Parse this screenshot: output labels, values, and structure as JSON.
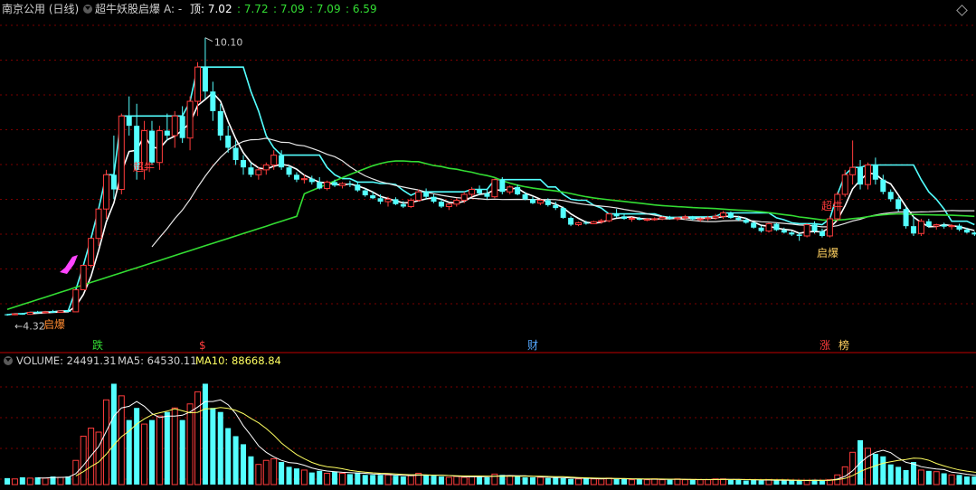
{
  "header": {
    "stock_label": "南京公用 (日线)",
    "indicator_name": "超牛妖股启爆",
    "a_label": "A: -",
    "top_label": "顶: 7.02",
    "v1": ": 7.72",
    "v2": ": 7.09",
    "v3": ": 7.09",
    "v4": ": 6.59"
  },
  "volume_header": {
    "volume": "VOLUME: 24491.31",
    "ma5": "MA5: 64530.11",
    "ma10": "MA10: 88668.84"
  },
  "colors": {
    "up": "#ff3c3c",
    "down": "#54ffff",
    "white_line": "#ffffff",
    "cyan_line": "#54ffff",
    "green_line": "#33dd33",
    "grid": "#7a0000",
    "ma10": "#ffff60",
    "magenta": "#ff44ff"
  },
  "chart_data": {
    "type": "candlestick",
    "price_ylim": [
      4.0,
      10.5
    ],
    "high_label": "10.10",
    "low_label": "4.32",
    "candles": [
      [
        4.45,
        4.46,
        4.42,
        4.44
      ],
      [
        4.44,
        4.47,
        4.43,
        4.46
      ],
      [
        4.46,
        4.48,
        4.44,
        4.45
      ],
      [
        4.45,
        4.5,
        4.44,
        4.49
      ],
      [
        4.49,
        4.52,
        4.47,
        4.48
      ],
      [
        4.48,
        4.52,
        4.47,
        4.5
      ],
      [
        4.5,
        4.54,
        4.48,
        4.49
      ],
      [
        4.49,
        4.53,
        4.48,
        4.52
      ],
      [
        4.52,
        4.55,
        4.5,
        4.5
      ],
      [
        4.5,
        4.95,
        4.5,
        4.95
      ],
      [
        4.95,
        5.45,
        4.95,
        5.45
      ],
      [
        5.45,
        6.0,
        5.4,
        6.0
      ],
      [
        6.0,
        6.6,
        5.85,
        6.6
      ],
      [
        6.6,
        7.4,
        6.4,
        7.3
      ],
      [
        7.3,
        8.1,
        6.8,
        7.0
      ],
      [
        7.0,
        8.55,
        6.9,
        8.5
      ],
      [
        8.5,
        8.9,
        8.1,
        8.3
      ],
      [
        8.3,
        8.75,
        7.2,
        7.4
      ],
      [
        7.4,
        8.4,
        7.2,
        8.2
      ],
      [
        8.2,
        8.4,
        7.5,
        7.55
      ],
      [
        7.55,
        8.3,
        7.4,
        8.2
      ],
      [
        8.2,
        8.55,
        8.0,
        8.1
      ],
      [
        8.1,
        8.6,
        7.85,
        8.5
      ],
      [
        8.5,
        8.7,
        7.95,
        8.05
      ],
      [
        8.05,
        8.9,
        7.8,
        8.8
      ],
      [
        8.8,
        9.6,
        8.5,
        9.5
      ],
      [
        9.5,
        10.1,
        8.85,
        9.0
      ],
      [
        9.0,
        9.2,
        8.4,
        8.6
      ],
      [
        8.6,
        8.75,
        8.0,
        8.1
      ],
      [
        8.1,
        8.3,
        7.75,
        7.85
      ],
      [
        7.85,
        8.0,
        7.5,
        7.6
      ],
      [
        7.6,
        7.7,
        7.3,
        7.45
      ],
      [
        7.45,
        7.55,
        7.25,
        7.3
      ],
      [
        7.3,
        7.45,
        7.2,
        7.4
      ],
      [
        7.4,
        7.55,
        7.3,
        7.5
      ],
      [
        7.5,
        7.8,
        7.4,
        7.7
      ],
      [
        7.7,
        7.8,
        7.4,
        7.45
      ],
      [
        7.45,
        7.5,
        7.25,
        7.3
      ],
      [
        7.3,
        7.35,
        7.15,
        7.2
      ],
      [
        7.2,
        7.3,
        7.12,
        7.22
      ],
      [
        7.22,
        7.28,
        7.1,
        7.15
      ],
      [
        7.15,
        7.25,
        7.0,
        7.02
      ],
      [
        7.02,
        7.18,
        6.98,
        7.15
      ],
      [
        7.15,
        7.2,
        7.05,
        7.08
      ],
      [
        7.08,
        7.15,
        7.02,
        7.12
      ],
      [
        7.12,
        7.18,
        7.05,
        7.1
      ],
      [
        7.1,
        7.15,
        6.95,
        6.98
      ],
      [
        6.98,
        7.02,
        6.85,
        6.88
      ],
      [
        6.88,
        6.95,
        6.8,
        6.82
      ],
      [
        6.82,
        6.9,
        6.7,
        6.75
      ],
      [
        6.75,
        6.85,
        6.65,
        6.8
      ],
      [
        6.8,
        6.84,
        6.68,
        6.7
      ],
      [
        6.7,
        6.76,
        6.62,
        6.65
      ],
      [
        6.65,
        6.82,
        6.62,
        6.78
      ],
      [
        6.78,
        7.0,
        6.75,
        6.95
      ],
      [
        6.95,
        7.02,
        6.8,
        6.85
      ],
      [
        6.85,
        6.9,
        6.72,
        6.75
      ],
      [
        6.75,
        6.8,
        6.62,
        6.65
      ],
      [
        6.65,
        6.72,
        6.58,
        6.7
      ],
      [
        6.7,
        6.82,
        6.65,
        6.78
      ],
      [
        6.78,
        6.95,
        6.72,
        6.9
      ],
      [
        6.9,
        7.05,
        6.85,
        7.0
      ],
      [
        7.0,
        7.08,
        6.88,
        6.92
      ],
      [
        6.92,
        7.0,
        6.8,
        6.85
      ],
      [
        6.85,
        7.22,
        6.82,
        7.2
      ],
      [
        7.2,
        7.25,
        6.9,
        6.95
      ],
      [
        6.95,
        7.08,
        6.9,
        7.05
      ],
      [
        7.05,
        7.1,
        6.88,
        6.9
      ],
      [
        6.9,
        6.95,
        6.78,
        6.8
      ],
      [
        6.8,
        6.85,
        6.7,
        6.72
      ],
      [
        6.72,
        6.8,
        6.68,
        6.78
      ],
      [
        6.78,
        6.82,
        6.65,
        6.68
      ],
      [
        6.68,
        6.75,
        6.58,
        6.62
      ],
      [
        6.62,
        6.65,
        6.4,
        6.42
      ],
      [
        6.42,
        6.45,
        6.25,
        6.28
      ],
      [
        6.28,
        6.34,
        6.25,
        6.32
      ],
      [
        6.32,
        6.36,
        6.28,
        6.3
      ],
      [
        6.3,
        6.36,
        6.29,
        6.34
      ],
      [
        6.34,
        6.4,
        6.3,
        6.36
      ],
      [
        6.36,
        6.52,
        6.33,
        6.5
      ],
      [
        6.5,
        6.6,
        6.42,
        6.45
      ],
      [
        6.45,
        6.5,
        6.38,
        6.4
      ],
      [
        6.4,
        6.44,
        6.34,
        6.41
      ],
      [
        6.41,
        6.44,
        6.37,
        6.38
      ],
      [
        6.38,
        6.42,
        6.35,
        6.39
      ],
      [
        6.39,
        6.43,
        6.36,
        6.4
      ],
      [
        6.4,
        6.45,
        6.37,
        6.43
      ],
      [
        6.43,
        6.46,
        6.38,
        6.4
      ],
      [
        6.4,
        6.44,
        6.36,
        6.42
      ],
      [
        6.42,
        6.48,
        6.38,
        6.44
      ],
      [
        6.44,
        6.46,
        6.37,
        6.39
      ],
      [
        6.39,
        6.43,
        6.34,
        6.4
      ],
      [
        6.4,
        6.46,
        6.36,
        6.42
      ],
      [
        6.42,
        6.5,
        6.38,
        6.45
      ],
      [
        6.45,
        6.56,
        6.4,
        6.52
      ],
      [
        6.52,
        6.55,
        6.4,
        6.42
      ],
      [
        6.42,
        6.46,
        6.36,
        6.38
      ],
      [
        6.38,
        6.42,
        6.3,
        6.32
      ],
      [
        6.32,
        6.34,
        6.2,
        6.22
      ],
      [
        6.22,
        6.26,
        6.12,
        6.15
      ],
      [
        6.15,
        6.32,
        6.12,
        6.3
      ],
      [
        6.3,
        6.32,
        6.15,
        6.17
      ],
      [
        6.17,
        6.22,
        6.1,
        6.12
      ],
      [
        6.12,
        6.15,
        6.05,
        6.08
      ],
      [
        6.08,
        6.12,
        5.95,
        6.05
      ],
      [
        6.05,
        6.3,
        6.02,
        6.28
      ],
      [
        6.28,
        6.35,
        6.1,
        6.15
      ],
      [
        6.15,
        6.2,
        6.02,
        6.05
      ],
      [
        6.05,
        6.45,
        6.02,
        6.4
      ],
      [
        6.4,
        6.95,
        6.35,
        6.9
      ],
      [
        6.9,
        7.4,
        6.85,
        7.3
      ],
      [
        7.3,
        8.0,
        7.1,
        7.45
      ],
      [
        7.45,
        7.6,
        7.0,
        7.1
      ],
      [
        7.1,
        7.55,
        7.0,
        7.5
      ],
      [
        7.5,
        7.65,
        7.1,
        7.2
      ],
      [
        7.2,
        7.3,
        6.9,
        6.95
      ],
      [
        6.95,
        7.0,
        6.75,
        6.8
      ],
      [
        6.8,
        6.85,
        6.55,
        6.6
      ],
      [
        6.6,
        6.65,
        6.2,
        6.25
      ],
      [
        6.25,
        6.45,
        6.05,
        6.1
      ],
      [
        6.1,
        6.4,
        6.05,
        6.35
      ],
      [
        6.35,
        6.4,
        6.22,
        6.25
      ],
      [
        6.25,
        6.3,
        6.18,
        6.28
      ],
      [
        6.28,
        6.32,
        6.2,
        6.24
      ],
      [
        6.24,
        6.29,
        6.18,
        6.26
      ],
      [
        6.26,
        6.3,
        6.15,
        6.18
      ],
      [
        6.18,
        6.22,
        6.1,
        6.12
      ],
      [
        6.12,
        6.14,
        6.05,
        6.08
      ]
    ],
    "volumes": [
      8,
      7,
      9,
      8,
      9,
      8,
      10,
      9,
      10,
      30,
      60,
      70,
      65,
      105,
      125,
      110,
      80,
      95,
      75,
      80,
      85,
      90,
      95,
      80,
      100,
      115,
      125,
      95,
      90,
      70,
      60,
      50,
      35,
      25,
      30,
      32,
      28,
      22,
      20,
      18,
      15,
      17,
      14,
      16,
      14,
      13,
      15,
      12,
      12,
      12,
      12,
      11,
      10,
      11,
      14,
      12,
      11,
      10,
      9,
      10,
      9,
      10,
      11,
      9,
      13,
      12,
      11,
      10,
      9,
      9,
      9,
      8,
      9,
      8,
      7,
      7,
      8,
      7,
      7,
      8,
      7,
      7,
      6,
      7,
      6,
      7,
      6,
      6,
      7,
      6,
      6,
      6,
      6,
      7,
      7,
      6,
      6,
      5,
      6,
      5,
      6,
      5,
      5,
      5,
      5,
      5,
      6,
      5,
      6,
      12,
      22,
      40,
      55,
      45,
      38,
      35,
      25,
      22,
      18,
      28,
      18,
      17,
      16,
      14,
      12,
      12,
      10,
      10,
      8
    ],
    "white_line": [
      [
        4.62,
        [
          0,
          4.6
        ],
        [
          1,
          4.62
        ],
        [
          2,
          4.64
        ],
        [
          3,
          4.66
        ],
        [
          4,
          4.7
        ],
        [
          5,
          4.74
        ],
        [
          6,
          4.78
        ],
        [
          7,
          4.82
        ],
        [
          8,
          4.86
        ],
        [
          9,
          4.92
        ]
      ]
    ],
    "annotations": {
      "qibao_1": "启爆",
      "qibao_2": "启爆",
      "chaoniu_1": "超牛",
      "chaoniu_2": "超牛",
      "die": "跌",
      "dollar": "$",
      "cai": "财",
      "zhang": "涨",
      "bang": "榜"
    }
  }
}
